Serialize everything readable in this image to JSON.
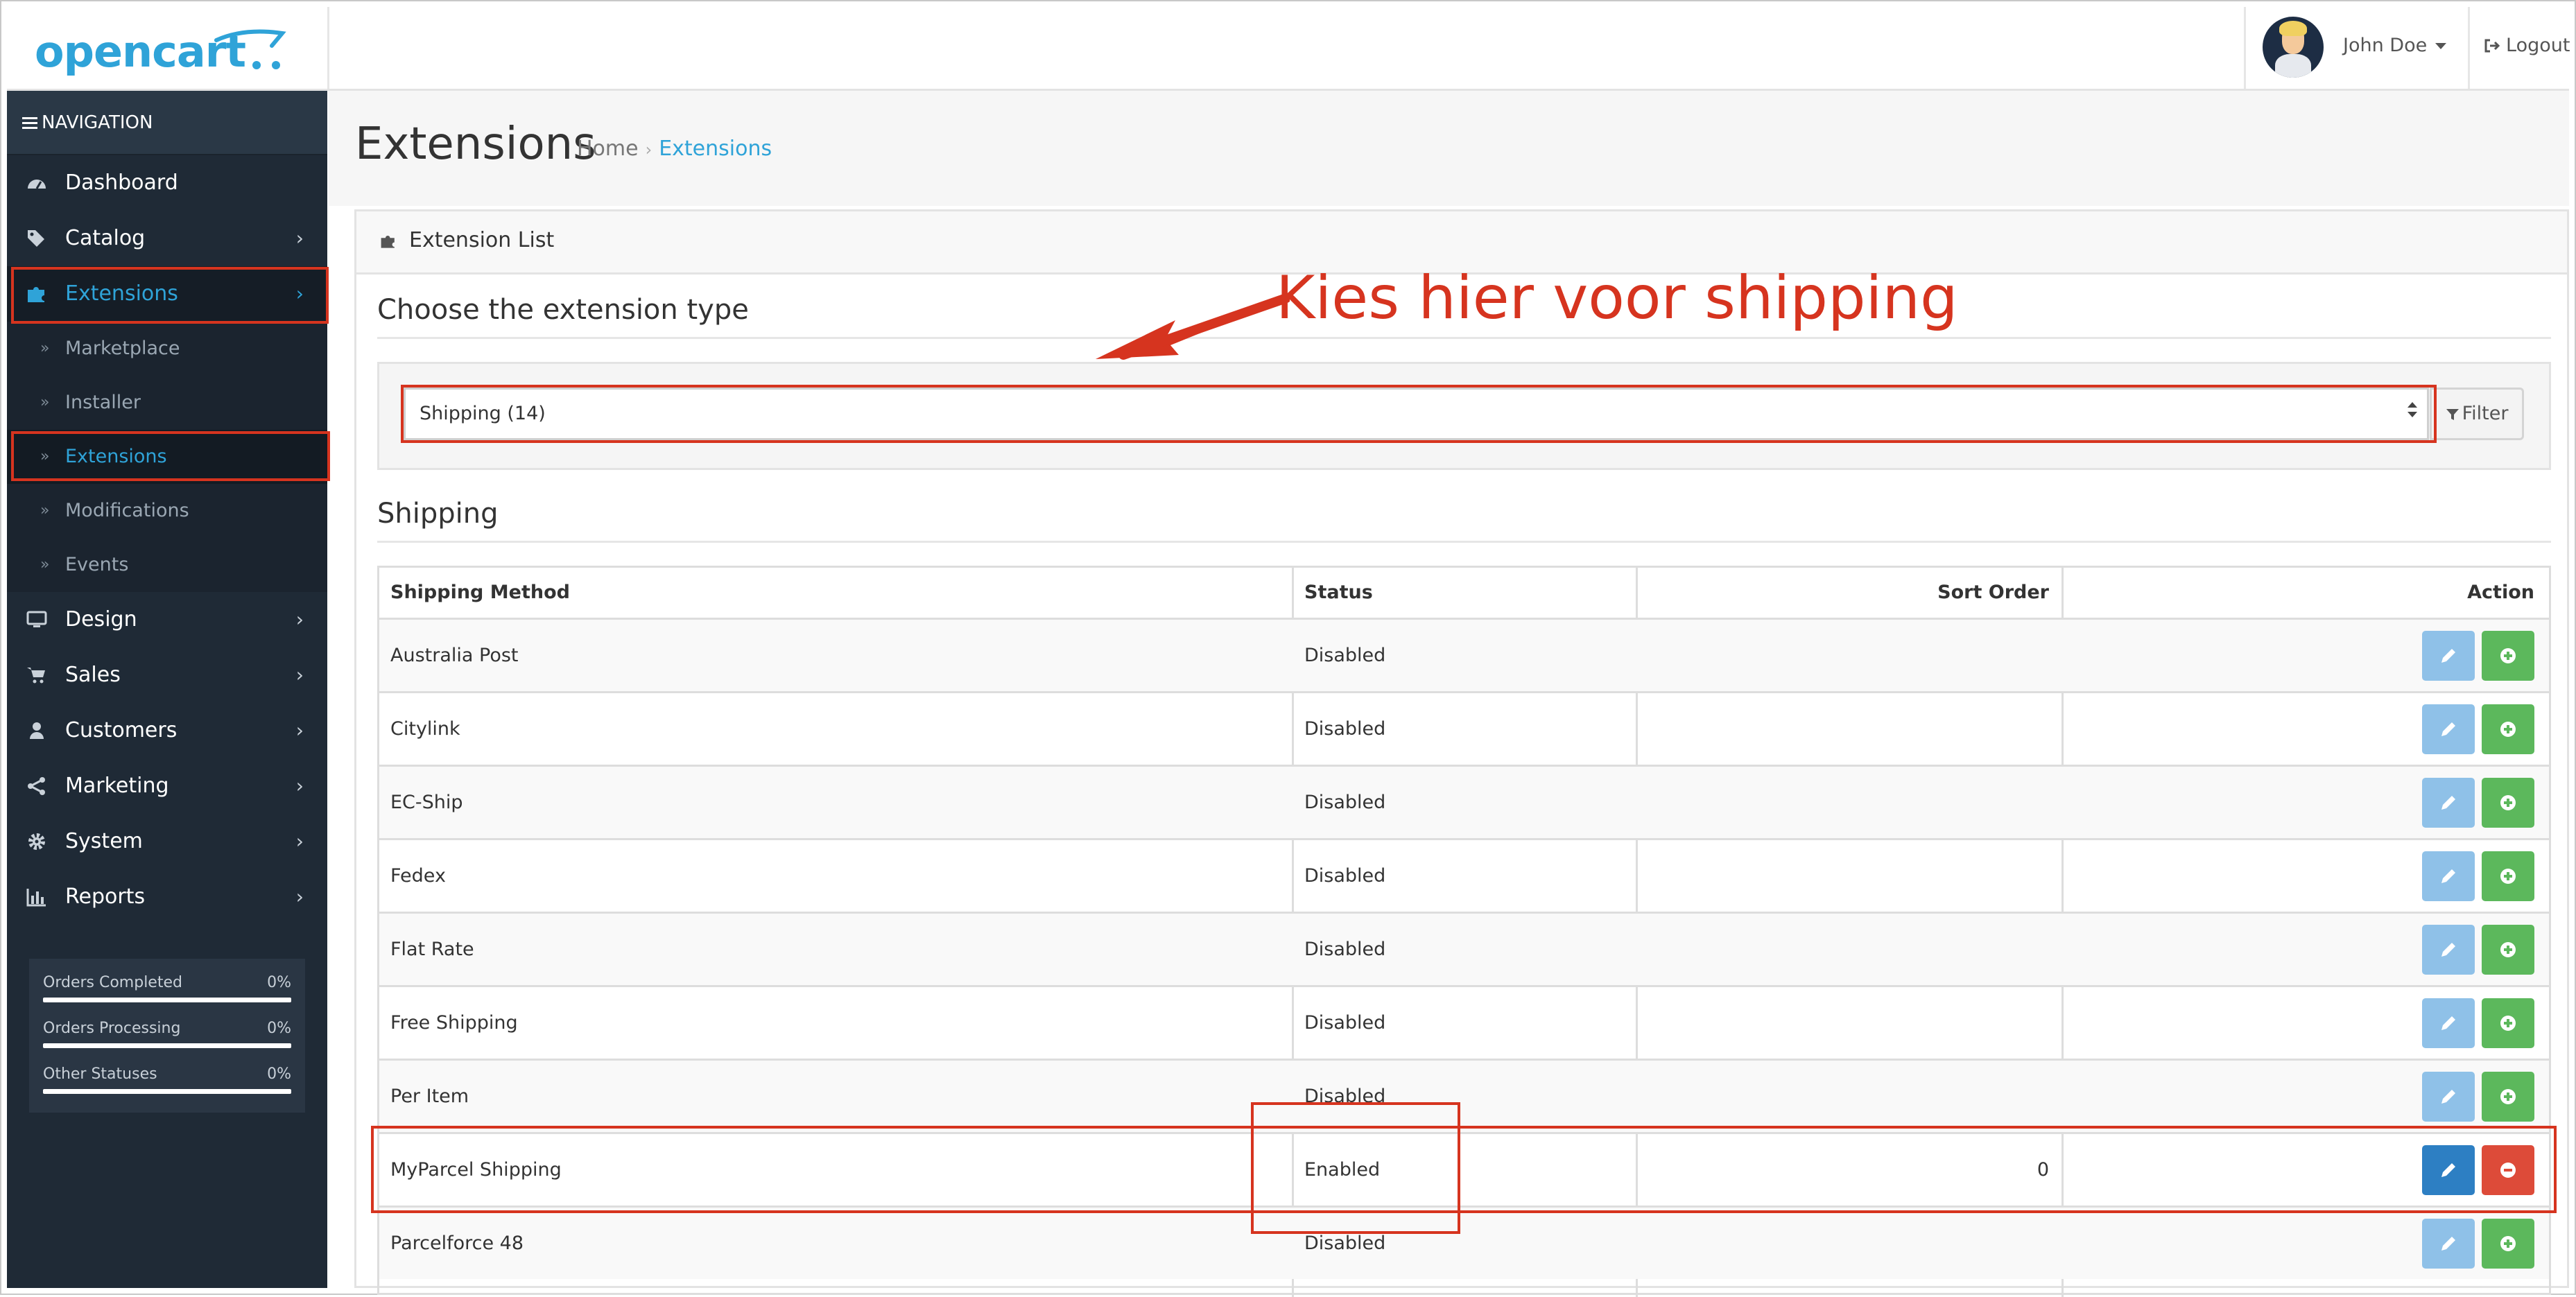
{
  "header": {
    "logo_text": "opencart",
    "user_name": "John Doe",
    "logout_label": "Logout"
  },
  "sidebar": {
    "nav_title": "NAVIGATION",
    "items": [
      {
        "label": "Dashboard",
        "icon": "dashboard-icon"
      },
      {
        "label": "Catalog",
        "icon": "tags-icon"
      },
      {
        "label": "Extensions",
        "icon": "puzzle-icon"
      },
      {
        "label": "Design",
        "icon": "desktop-icon"
      },
      {
        "label": "Sales",
        "icon": "cart-icon"
      },
      {
        "label": "Customers",
        "icon": "user-icon"
      },
      {
        "label": "Marketing",
        "icon": "share-icon"
      },
      {
        "label": "System",
        "icon": "gear-icon"
      },
      {
        "label": "Reports",
        "icon": "bar-chart-icon"
      }
    ],
    "subitems": [
      "Marketplace",
      "Installer",
      "Extensions",
      "Modifications",
      "Events"
    ],
    "stats": [
      {
        "label": "Orders Completed",
        "value": "0%"
      },
      {
        "label": "Orders Processing",
        "value": "0%"
      },
      {
        "label": "Other Statuses",
        "value": "0%"
      }
    ]
  },
  "page": {
    "title": "Extensions",
    "breadcrumb_home": "Home",
    "breadcrumb_current": "Extensions"
  },
  "panel": {
    "title": "Extension List",
    "choose_heading": "Choose the extension type",
    "select_value": "Shipping (14)",
    "filter_label": "Filter",
    "section_heading": "Shipping"
  },
  "annotation": {
    "text": "Kies hier voor shipping"
  },
  "table": {
    "headers": {
      "method": "Shipping Method",
      "status": "Status",
      "sort_order": "Sort Order",
      "action": "Action"
    },
    "rows": [
      {
        "method": "Australia Post",
        "status": "Disabled",
        "sort_order": "",
        "installed": false
      },
      {
        "method": "Citylink",
        "status": "Disabled",
        "sort_order": "",
        "installed": false
      },
      {
        "method": "EC-Ship",
        "status": "Disabled",
        "sort_order": "",
        "installed": false
      },
      {
        "method": "Fedex",
        "status": "Disabled",
        "sort_order": "",
        "installed": false
      },
      {
        "method": "Flat Rate",
        "status": "Disabled",
        "sort_order": "",
        "installed": false
      },
      {
        "method": "Free Shipping",
        "status": "Disabled",
        "sort_order": "",
        "installed": false
      },
      {
        "method": "Per Item",
        "status": "Disabled",
        "sort_order": "",
        "installed": false
      },
      {
        "method": "MyParcel Shipping",
        "status": "Enabled",
        "sort_order": "0",
        "installed": true
      },
      {
        "method": "Parcelforce 48",
        "status": "Disabled",
        "sort_order": "",
        "installed": false
      }
    ]
  },
  "colors": {
    "brand": "#2fa3d8",
    "sidebar_bg": "#1f2a36",
    "annotation_red": "#d6341f",
    "install_green": "#5cb85c",
    "uninstall_red": "#dd4b39",
    "edit_blue": "#2d7fc3"
  }
}
